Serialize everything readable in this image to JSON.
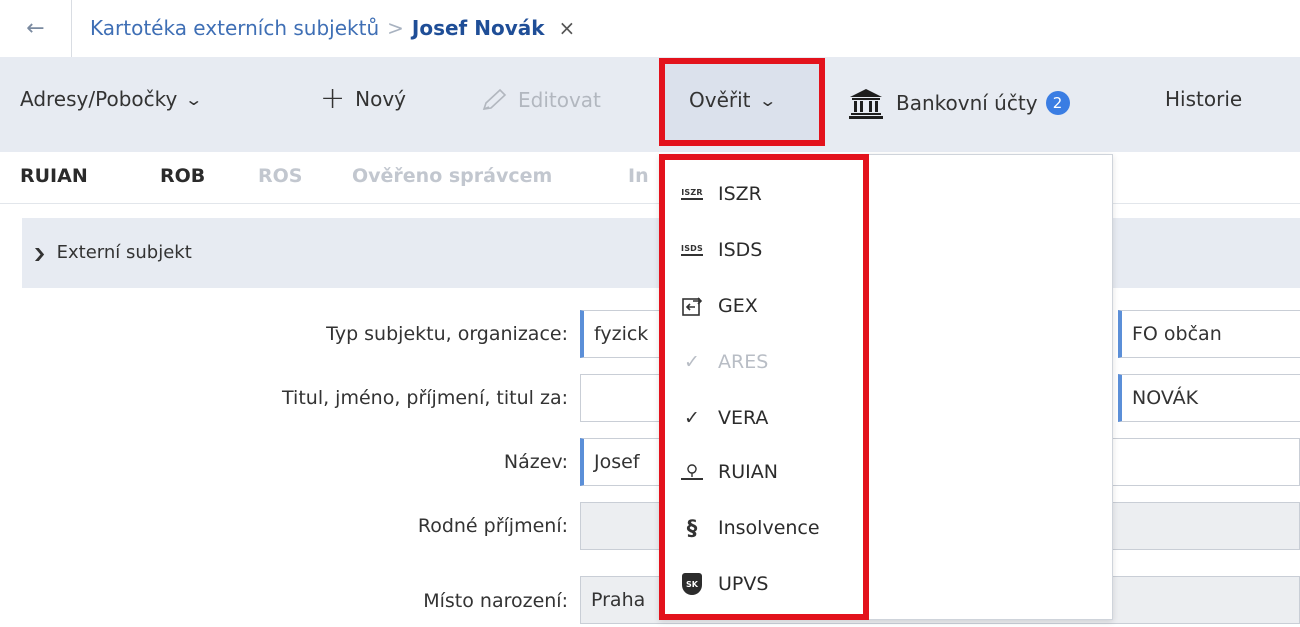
{
  "breadcrumb": {
    "back_icon": "arrow-left-icon",
    "parent": "Kartotéka externích subjektů",
    "separator": ">",
    "current": "Josef Novák",
    "close": "×"
  },
  "toolbar": {
    "addresses": "Adresy/Pobočky",
    "new": "Nový",
    "edit": "Editovat",
    "verify": "Ověřit",
    "bank_accounts": "Bankovní účty",
    "bank_badge": "2",
    "history": "Historie"
  },
  "subtabs": {
    "ruian": "RUIAN",
    "rob": "ROB",
    "ros": "ROS",
    "verified": "Ověřeno správcem",
    "partial": "In"
  },
  "section": {
    "title": "Externí subjekt"
  },
  "form": {
    "type_label": "Typ subjektu, organizace:",
    "type_value": "fyzick",
    "type_value2": "FO občan",
    "name_label": "Titul, jméno, příjmení, titul za:",
    "surname_value": "NOVÁK",
    "title_label": "Název:",
    "title_value": "Josef",
    "birth_surname_label": "Rodné příjmení:",
    "birthplace_label": "Místo narození:",
    "birthplace_value": "Praha"
  },
  "menu": {
    "items": [
      {
        "label": "ISZR",
        "icon": "iszr-icon",
        "tag": "ISZR"
      },
      {
        "label": "ISDS",
        "icon": "isds-icon",
        "tag": "ISDS"
      },
      {
        "label": "GEX",
        "icon": "exchange-icon"
      },
      {
        "label": "ARES",
        "icon": "check-icon",
        "disabled": true
      },
      {
        "label": "VERA",
        "icon": "check-icon"
      },
      {
        "label": "RUIAN",
        "icon": "map-pin-icon"
      },
      {
        "label": "Insolvence",
        "icon": "paragraph-icon",
        "glyph": "§"
      },
      {
        "label": "UPVS",
        "icon": "sk-shield-icon",
        "tag": "SK"
      }
    ]
  },
  "colors": {
    "highlight": "#e3121c",
    "link": "#3f6fb5",
    "badge": "#3a7de3",
    "toolbar_bg": "#e7ebf2"
  }
}
